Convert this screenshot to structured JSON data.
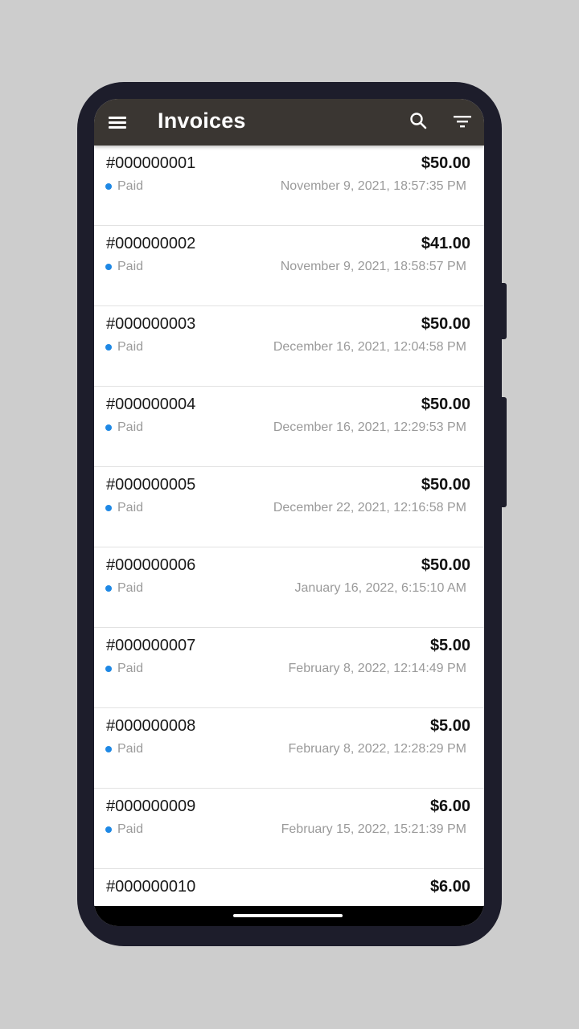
{
  "appbar": {
    "title": "Invoices",
    "menu_icon": "menu-icon",
    "search_icon": "search-icon",
    "filter_icon": "filter-icon",
    "background": "#3a3632"
  },
  "status_color": "#1e88e5",
  "invoices": [
    {
      "number": "#000000001",
      "amount": "$50.00",
      "status": "Paid",
      "date": "November 9, 2021, 18:57:35 PM"
    },
    {
      "number": "#000000002",
      "amount": "$41.00",
      "status": "Paid",
      "date": "November 9, 2021, 18:58:57 PM"
    },
    {
      "number": "#000000003",
      "amount": "$50.00",
      "status": "Paid",
      "date": "December 16, 2021, 12:04:58 PM"
    },
    {
      "number": "#000000004",
      "amount": "$50.00",
      "status": "Paid",
      "date": "December 16, 2021, 12:29:53 PM"
    },
    {
      "number": "#000000005",
      "amount": "$50.00",
      "status": "Paid",
      "date": "December 22, 2021, 12:16:58 PM"
    },
    {
      "number": "#000000006",
      "amount": "$50.00",
      "status": "Paid",
      "date": "January 16, 2022, 6:15:10 AM"
    },
    {
      "number": "#000000007",
      "amount": "$5.00",
      "status": "Paid",
      "date": "February 8, 2022, 12:14:49 PM"
    },
    {
      "number": "#000000008",
      "amount": "$5.00",
      "status": "Paid",
      "date": "February 8, 2022, 12:28:29 PM"
    },
    {
      "number": "#000000009",
      "amount": "$6.00",
      "status": "Paid",
      "date": "February 15, 2022, 15:21:39 PM"
    },
    {
      "number": "#000000010",
      "amount": "$6.00",
      "status": "",
      "date": ""
    }
  ]
}
